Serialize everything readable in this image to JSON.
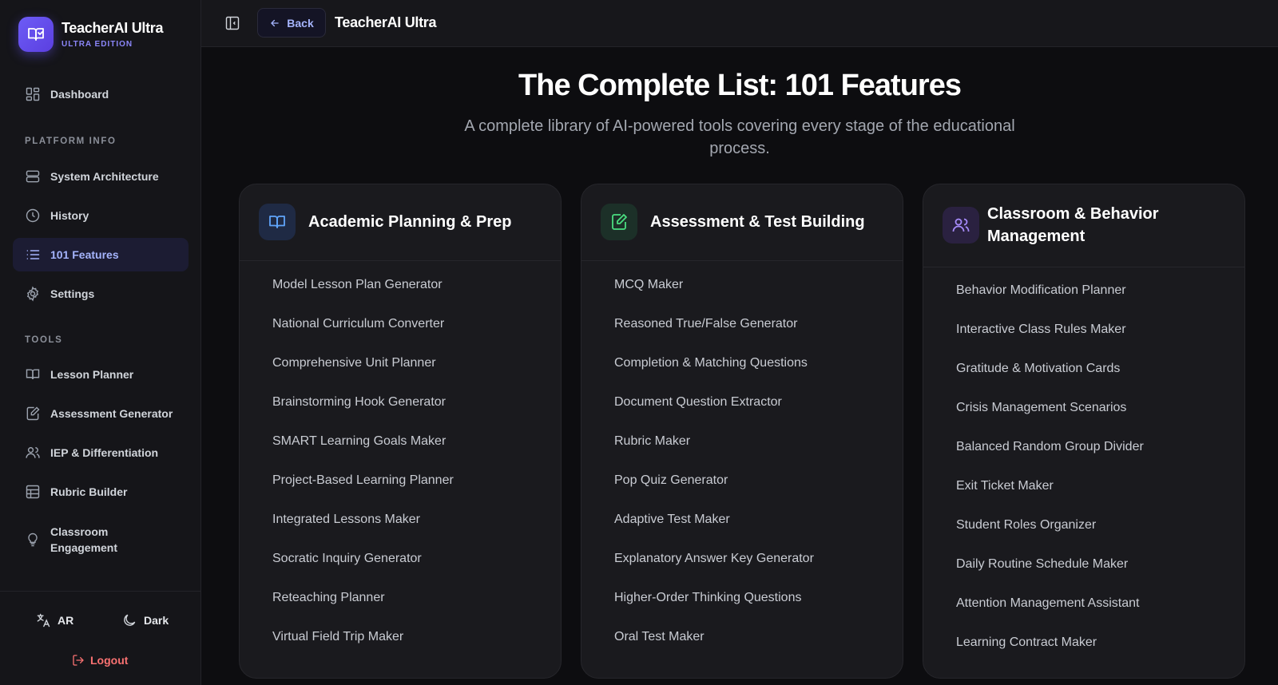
{
  "brand": {
    "title": "TeacherAI Ultra",
    "subtitle": "ULTRA EDITION"
  },
  "sidebar": {
    "dashboard": "Dashboard",
    "platform_label": "PLATFORM INFO",
    "platform_items": [
      "System Architecture",
      "History",
      "101 Features",
      "Settings"
    ],
    "tools_label": "TOOLS",
    "tools_items": [
      "Lesson Planner",
      "Assessment Generator",
      "IEP & Differentiation",
      "Rubric Builder",
      "Classroom Engagement"
    ],
    "active_item": "101 Features",
    "lang_label": "AR",
    "theme_label": "Dark",
    "logout_label": "Logout"
  },
  "topbar": {
    "back_label": "Back",
    "title": "TeacherAI Ultra"
  },
  "main": {
    "title": "The Complete List: 101 Features",
    "subtitle": "A complete library of AI-powered tools covering every stage of the educational process."
  },
  "colors": {
    "accent": "#6d5cf6",
    "accent_text": "#a5b4fc",
    "logout": "#f87171",
    "assessment_icon": "#4ade80",
    "behavior_icon": "#a78bfa"
  },
  "categories": [
    {
      "title": "Academic Planning & Prep",
      "icon": "open-book-icon",
      "features": [
        "Model Lesson Plan Generator",
        "National Curriculum Converter",
        "Comprehensive Unit Planner",
        "Brainstorming Hook Generator",
        "SMART Learning Goals Maker",
        "Project-Based Learning Planner",
        "Integrated Lessons Maker",
        "Socratic Inquiry Generator",
        "Reteaching Planner",
        "Virtual Field Trip Maker"
      ]
    },
    {
      "title": "Assessment & Test Building",
      "icon": "edit-document-icon",
      "features": [
        "MCQ Maker",
        "Reasoned True/False Generator",
        "Completion & Matching Questions",
        "Document Question Extractor",
        "Rubric Maker",
        "Pop Quiz Generator",
        "Adaptive Test Maker",
        "Explanatory Answer Key Generator",
        "Higher-Order Thinking Questions",
        "Oral Test Maker"
      ]
    },
    {
      "title": "Classroom & Behavior Management",
      "icon": "users-icon",
      "features": [
        "Behavior Modification Planner",
        "Interactive Class Rules Maker",
        "Gratitude & Motivation Cards",
        "Crisis Management Scenarios",
        "Balanced Random Group Divider",
        "Exit Ticket Maker",
        "Student Roles Organizer",
        "Daily Routine Schedule Maker",
        "Attention Management Assistant",
        "Learning Contract Maker"
      ]
    }
  ]
}
